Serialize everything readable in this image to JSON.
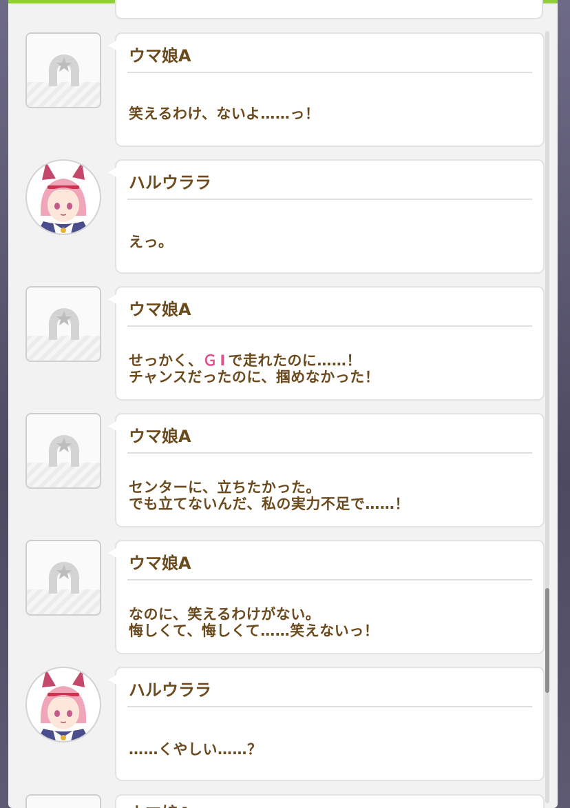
{
  "messages": [
    {
      "speaker": "ウマ娘A",
      "avatar": "horseshoe-placeholder-icon",
      "lines": [
        "笑えるわけ、ないよ……っ！"
      ]
    },
    {
      "speaker": "ハルウララ",
      "avatar": "haru-urara-portrait",
      "lines": [
        "えっ。"
      ]
    },
    {
      "speaker": "ウマ娘A",
      "avatar": "horseshoe-placeholder-icon",
      "line1_pre": "せっかく、",
      "line1_hl": "ＧⅠ",
      "line1_post": "で走れたのに……！",
      "lines": [
        "チャンスだったのに、掴めなかった！"
      ]
    },
    {
      "speaker": "ウマ娘A",
      "avatar": "horseshoe-placeholder-icon",
      "lines": [
        "センターに、立ちたかった。",
        "でも立てないんだ、私の実力不足で……！"
      ]
    },
    {
      "speaker": "ウマ娘A",
      "avatar": "horseshoe-placeholder-icon",
      "lines": [
        "なのに、笑えるわけがない。",
        "悔しくて、悔しくて……笑えないっ！"
      ]
    },
    {
      "speaker": "ハルウララ",
      "avatar": "haru-urara-portrait",
      "lines": [
        "……くやしい……？"
      ]
    },
    {
      "speaker": "ウマ娘A",
      "avatar": "horseshoe-placeholder-icon"
    }
  ],
  "colors": {
    "accent": "#8fcf3c",
    "text": "#6b4a1e",
    "highlight": "#e0508c"
  }
}
